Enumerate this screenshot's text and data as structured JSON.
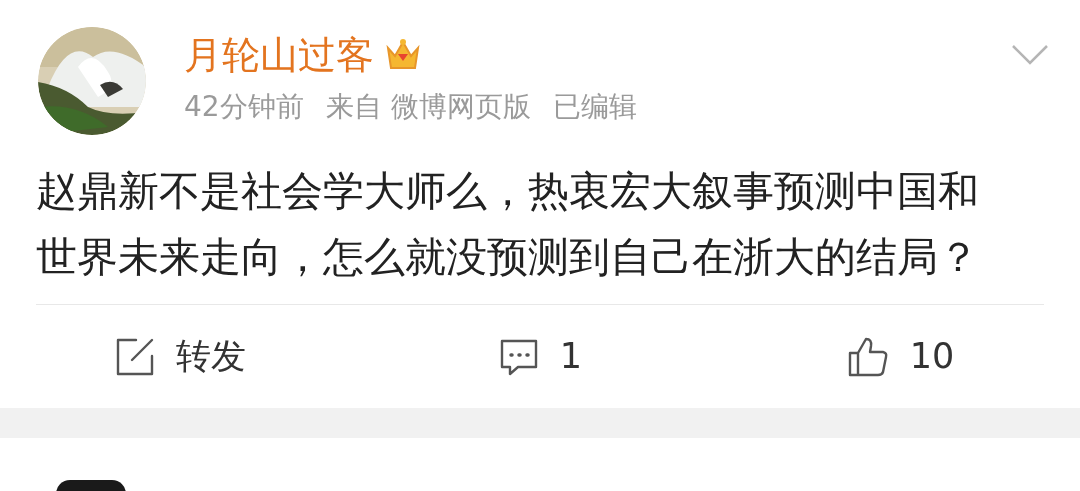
{
  "post": {
    "author": {
      "name": "月轮山过客",
      "verified_crown": true
    },
    "meta": [
      "42分钟前",
      "来自 微博网页版",
      "已编辑"
    ],
    "text": "赵鼎新不是社会学大师么，热衷宏大叙事预测中国和世界未来走向，怎么就没预测到自己在浙大的结局？",
    "actions": [
      {
        "kind": "repost",
        "label": "转发"
      },
      {
        "kind": "comment",
        "label": "1"
      },
      {
        "kind": "like",
        "label": "10"
      }
    ]
  }
}
